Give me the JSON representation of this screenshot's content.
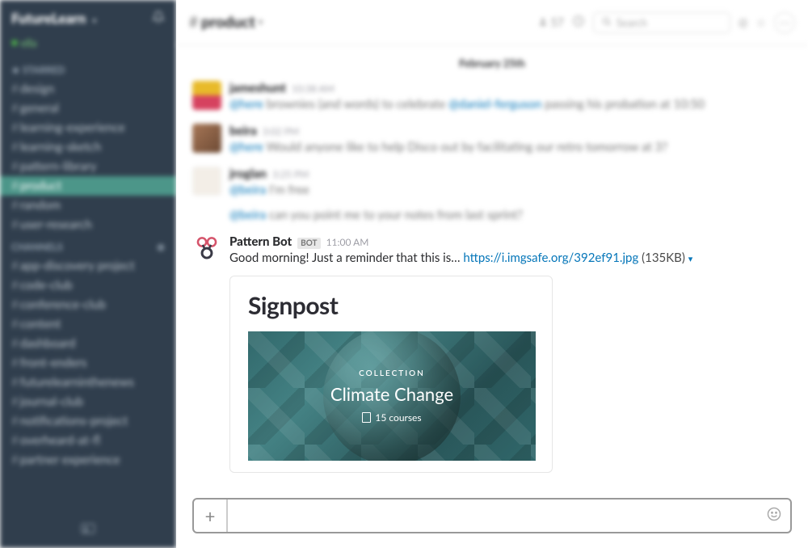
{
  "workspace": {
    "name": "FutureLearn",
    "presence": "ella"
  },
  "sidebar": {
    "starred_header": "STARRED",
    "channels_header": "CHANNELS",
    "starred": [
      {
        "label": "design"
      },
      {
        "label": "general"
      },
      {
        "label": "learning-experience"
      },
      {
        "label": "learning-sketch"
      },
      {
        "label": "pattern-library"
      },
      {
        "label": "product"
      },
      {
        "label": "random"
      },
      {
        "label": "user-research"
      }
    ],
    "channels": [
      {
        "label": "app-discovery project"
      },
      {
        "label": "code-club"
      },
      {
        "label": "conference-club"
      },
      {
        "label": "content"
      },
      {
        "label": "dashboard"
      },
      {
        "label": "front-enders"
      },
      {
        "label": "futurelearninthenews"
      },
      {
        "label": "journal-club"
      },
      {
        "label": "notifications-project"
      },
      {
        "label": "overheard-at-fl"
      },
      {
        "label": "partner experience"
      }
    ]
  },
  "header": {
    "channel": "product",
    "members": "57",
    "search_placeholder": "Search"
  },
  "date": "February 25th",
  "messages": {
    "blurred": [
      {
        "author": "jameshunt",
        "time": "10:38 AM",
        "prefix": "@here",
        "text": "brownies (and words) to celebrate",
        "mention": "@daniel-ferguson",
        "suffix": "passing his probation at 10:50"
      },
      {
        "author": "beira",
        "time": "3:02 PM",
        "prefix": "@here",
        "text": "Would anyone like to help Disco out by facilitating our retro tomorrow at 3?",
        "mention": "",
        "suffix": ""
      },
      {
        "author": "jroglan",
        "time": "3:25 PM",
        "prefix": "@beira",
        "text": "I'm free",
        "mention": "",
        "suffix": "",
        "line2_prefix": "@beira",
        "line2_text": "can you point me to your notes from last sprint?"
      }
    ],
    "bot": {
      "author": "Pattern Bot",
      "badge": "BOT",
      "time": "11:00 AM",
      "text": "Good morning! Just a reminder that this is…",
      "link": "https://i.imgsafe.org/392ef91.jpg",
      "size": "(135KB)"
    }
  },
  "attachment": {
    "title": "Signpost",
    "label": "COLLECTION",
    "heading": "Climate Change",
    "sub": "15 courses"
  }
}
